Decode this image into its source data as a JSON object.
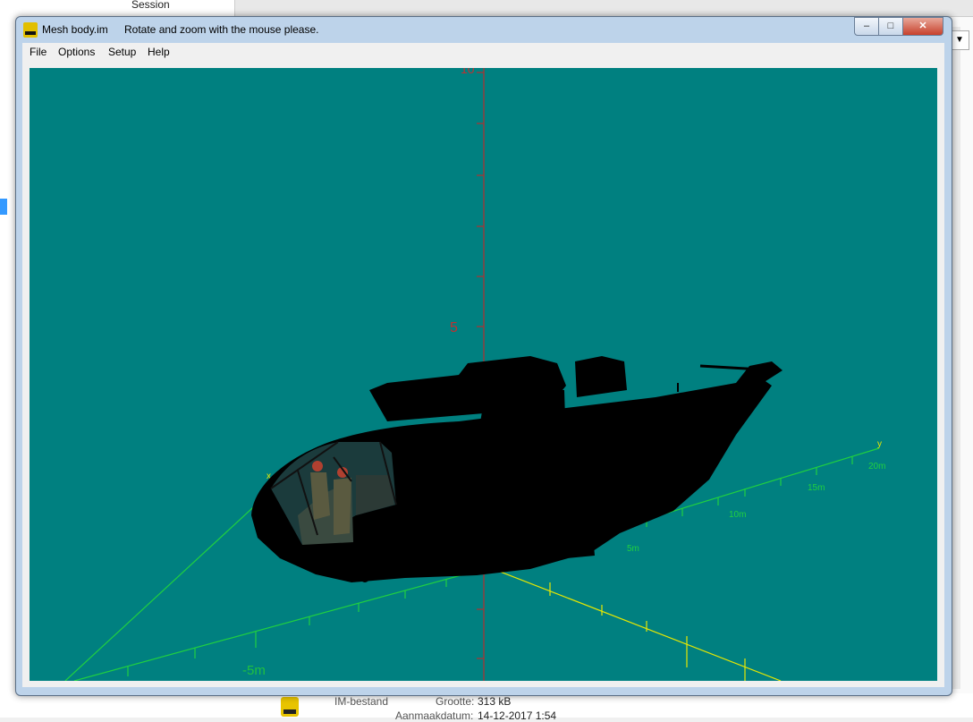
{
  "background": {
    "session_label": "Session",
    "file_type": "IM-bestand",
    "size_label": "Grootte:",
    "size_value": "313 kB",
    "date_label": "Aanmaakdatum:",
    "date_value": "14-12-2017 1:54"
  },
  "window": {
    "title": "Mesh body.im",
    "subtitle": "Rotate and zoom with the mouse please.",
    "buttons": {
      "minimize": "–",
      "maximize": "□",
      "close": "✕"
    }
  },
  "menu": [
    "File",
    "Options",
    "Setup",
    "Help"
  ],
  "viewport": {
    "background": "#008080",
    "axis_labels": {
      "z_top": "10",
      "z_mid": "5",
      "x_left": "-5m",
      "y_5": "5m",
      "y_10": "10m",
      "y_15": "15m",
      "y_20": "20m",
      "y_axis": "y",
      "x_axis": "x"
    },
    "colors": {
      "z_axis": "#b03030",
      "x_axis": "#20d040",
      "y_axis": "#e8e800",
      "model": "#000000"
    }
  }
}
